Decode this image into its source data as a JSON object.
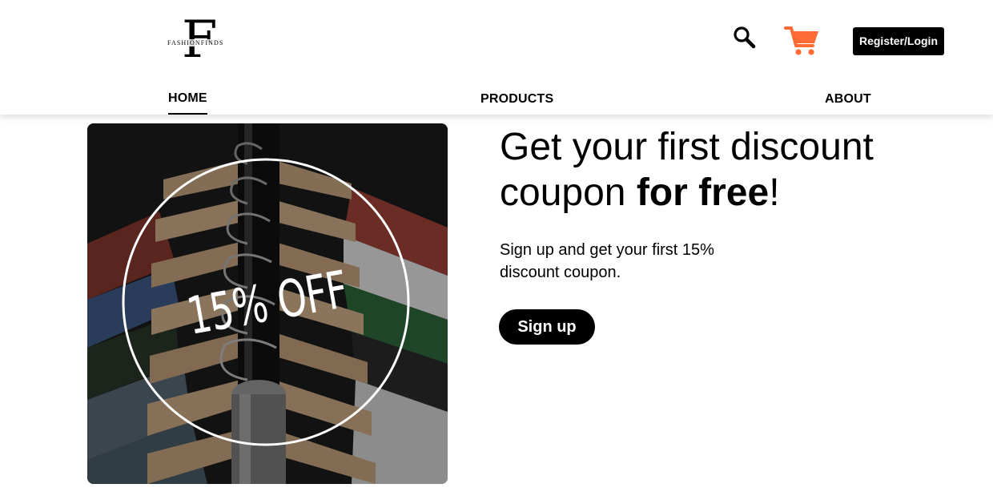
{
  "header": {
    "logo": {
      "letter": "F",
      "wordmark": "FASHIONFINDS"
    },
    "icons": {
      "search": "search-icon",
      "cart": "cart-icon"
    },
    "register_label": "Register/Login",
    "accent_color": "#ff6b35"
  },
  "nav": {
    "items": [
      {
        "label": "HOME",
        "active": true
      },
      {
        "label": "PRODUCTS",
        "active": false
      },
      {
        "label": "ABOUT",
        "active": false
      }
    ]
  },
  "hero": {
    "image_text": "15% OFF",
    "headline_part1": "Get your first discount coupon ",
    "headline_bold": "for free",
    "headline_end": "!",
    "subtext": "Sign up and get your first 15% discount coupon.",
    "signup_label": "Sign up"
  }
}
